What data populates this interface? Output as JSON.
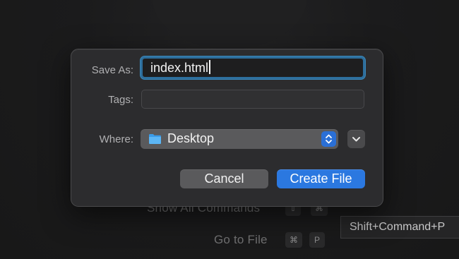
{
  "background": {
    "commands": [
      {
        "label": "Show All Commands",
        "keys": [
          "⇧",
          "⌘"
        ]
      },
      {
        "label": "Go to File",
        "keys": [
          "⌘",
          "P"
        ]
      }
    ],
    "tooltip": "Shift+Command+P"
  },
  "dialog": {
    "save_as_label": "Save As:",
    "filename": "index.html",
    "tags_label": "Tags:",
    "tags_value": "",
    "where_label": "Where:",
    "where_value": "Desktop",
    "where_icon": "folder-icon",
    "expand_icon": "chevron-down-icon",
    "stepper_icon": "up-down-chevron-icon",
    "cancel_label": "Cancel",
    "create_label": "Create File"
  },
  "colors": {
    "accent": "#2b78e0",
    "focus_ring": "#3b86b8",
    "dialog_bg": "#2c2c2e"
  }
}
